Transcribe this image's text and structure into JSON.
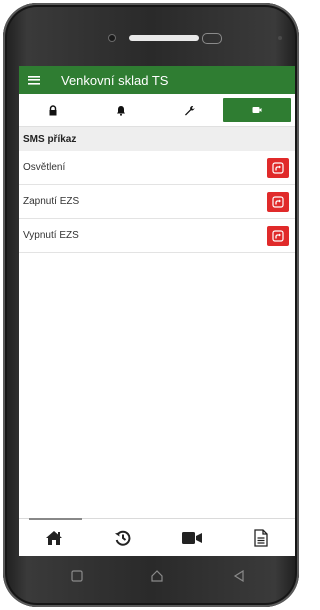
{
  "app": {
    "title": "Venkovní sklad TS"
  },
  "tabs": [
    {
      "icon": "lock-icon",
      "active": false
    },
    {
      "icon": "bell-icon",
      "active": false
    },
    {
      "icon": "wrench-icon",
      "active": false
    },
    {
      "icon": "sms-icon",
      "active": true
    }
  ],
  "section": {
    "title": "SMS příkaz"
  },
  "commands": [
    {
      "label": "Osvětlení",
      "action_icon": "send-icon"
    },
    {
      "label": "Zapnutí EZS",
      "action_icon": "send-icon"
    },
    {
      "label": "Vypnutí EZS",
      "action_icon": "send-icon"
    }
  ],
  "bottom_nav": [
    {
      "icon": "home-icon",
      "active": true
    },
    {
      "icon": "history-icon",
      "active": false
    },
    {
      "icon": "video-icon",
      "active": false
    },
    {
      "icon": "document-icon",
      "active": false
    }
  ],
  "colors": {
    "primary": "#2f7d32",
    "action": "#e02a2a"
  }
}
